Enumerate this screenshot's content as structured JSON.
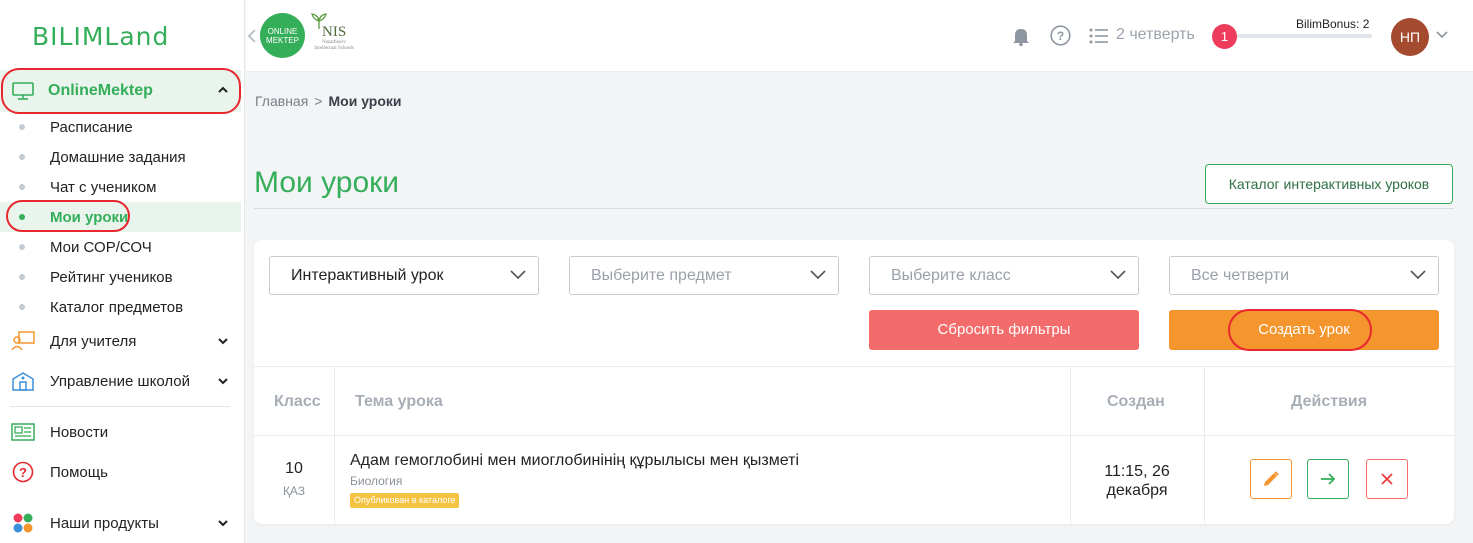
{
  "brand": {
    "logo_text": "BILIMLand",
    "accent": "#35ae5a"
  },
  "sidebar": {
    "main_item": {
      "label": "OnlineMektep",
      "icon": "monitor-icon"
    },
    "sub_items": [
      {
        "label": "Расписание"
      },
      {
        "label": "Домашние задания"
      },
      {
        "label": "Чат с учеником"
      },
      {
        "label": "Мои уроки",
        "active": true
      },
      {
        "label": "Мои СОР/СОЧ"
      },
      {
        "label": "Рейтинг учеников"
      },
      {
        "label": "Каталог предметов"
      }
    ],
    "groups": [
      {
        "label": "Для учителя",
        "icon": "teacher-icon"
      },
      {
        "label": "Управление школой",
        "icon": "school-icon"
      },
      {
        "label": "Новости",
        "icon": "news-icon"
      },
      {
        "label": "Помощь",
        "icon": "help-icon"
      },
      {
        "label": "Наши продукты",
        "icon": "products-icon"
      }
    ]
  },
  "header": {
    "online_mektep_logo": "ONLINE MEKTEP",
    "nis_logo": "NIS",
    "nis_caption": "Nazarbayev Intellectual Schools",
    "quarter": "2 четверть",
    "notification_count": "1",
    "bonus_label": "BilimBonus: 2",
    "bonus_value": 2,
    "avatar_initials": "НП"
  },
  "breadcrumb": {
    "home": "Главная",
    "separator": ">",
    "current": "Мои уроки"
  },
  "page": {
    "title": "Мои уроки",
    "catalog_button": "Каталог интерактивных уроков"
  },
  "filters": {
    "type_value": "Интерактивный урок",
    "subject_placeholder": "Выберите предмет",
    "class_placeholder": "Выберите класс",
    "quarter_value": "Все четверти",
    "reset_button": "Сбросить фильтры",
    "create_button": "Создать урок"
  },
  "table": {
    "headers": {
      "class": "Класс",
      "topic": "Тема урока",
      "created": "Создан",
      "actions": "Действия"
    },
    "rows": [
      {
        "class": "10",
        "language": "ҚАЗ",
        "topic": "Адам гемоглобині мен миоглобинінің құрылысы мен қызметі",
        "subject": "Биология",
        "tag": "Опубликован в каталоге",
        "created_line1": "11:15, 26",
        "created_line2": "декабря"
      }
    ]
  },
  "colors": {
    "reset": "#f36b6b",
    "create": "#f5952e",
    "tag": "#f5c342",
    "badge": "#ee3d5c",
    "highlight": "#e8272e"
  }
}
